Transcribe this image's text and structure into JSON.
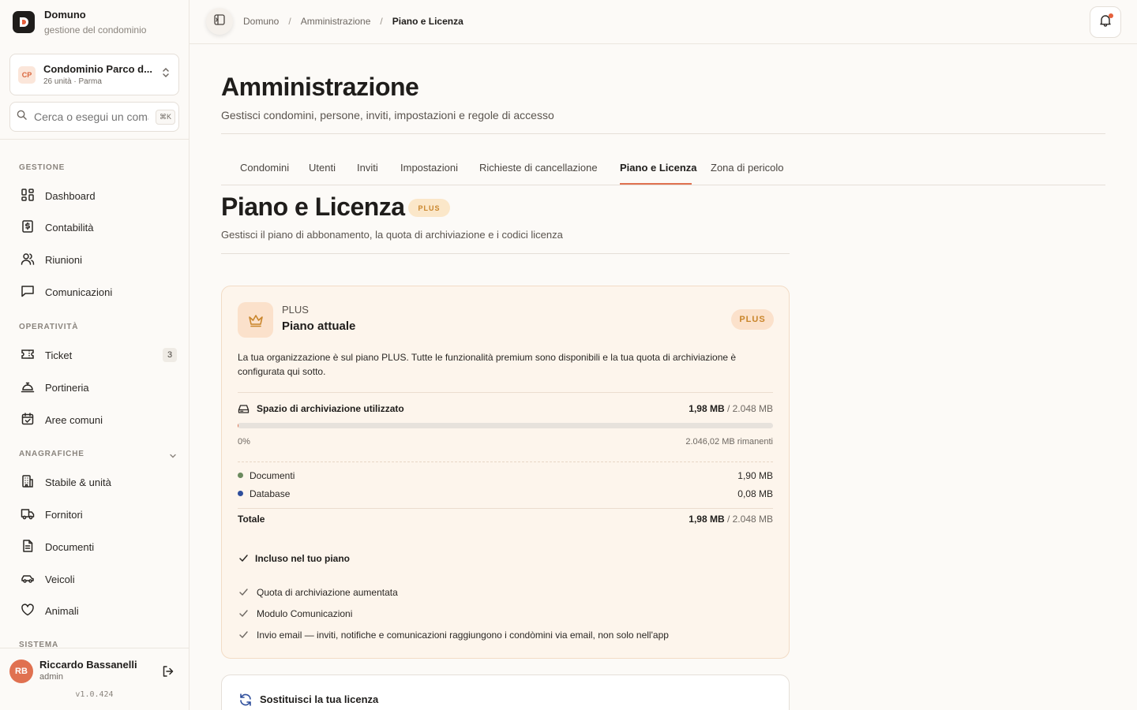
{
  "brand": {
    "name": "Domuno",
    "subtitle": "gestione del condominio"
  },
  "org": {
    "initials": "CP",
    "name": "Condominio Parco d...",
    "meta": "26 unità · Parma"
  },
  "search": {
    "placeholder": "Cerca o esegui un comando",
    "shortcut": "⌘K"
  },
  "sidebar": {
    "sections": [
      {
        "label": "GESTIONE"
      },
      {
        "label": "OPERATIVITÀ"
      },
      {
        "label": "ANAGRAFICHE"
      },
      {
        "label": "SISTEMA"
      }
    ],
    "items": [
      {
        "label": "Dashboard",
        "icon": "dashboard-icon"
      },
      {
        "label": "Contabilità",
        "icon": "ledger-icon"
      },
      {
        "label": "Riunioni",
        "icon": "users-icon"
      },
      {
        "label": "Comunicazioni",
        "icon": "message-icon"
      },
      {
        "label": "Ticket",
        "icon": "ticket-icon",
        "count": "3"
      },
      {
        "label": "Portineria",
        "icon": "concierge-bell-icon"
      },
      {
        "label": "Aree comuni",
        "icon": "calendar-check-icon"
      },
      {
        "label": "Stabile & unità",
        "icon": "building-icon"
      },
      {
        "label": "Fornitori",
        "icon": "truck-icon"
      },
      {
        "label": "Documenti",
        "icon": "document-icon"
      },
      {
        "label": "Veicoli",
        "icon": "car-icon"
      },
      {
        "label": "Animali",
        "icon": "heart-icon"
      }
    ]
  },
  "user": {
    "initials": "RB",
    "name": "Riccardo Bassanelli",
    "role": "admin",
    "version": "v1.0.424"
  },
  "breadcrumb": [
    "Domuno",
    "Amministrazione",
    "Piano e Licenza"
  ],
  "page": {
    "title": "Amministrazione",
    "subtitle": "Gestisci condomini, persone, inviti, impostazioni e regole di accesso"
  },
  "tabs": [
    "Condomini",
    "Utenti",
    "Inviti",
    "Impostazioni",
    "Richieste di cancellazione",
    "Piano e Licenza",
    "Zona di pericolo"
  ],
  "active_tab": "Piano e Licenza",
  "section": {
    "title": "Piano e Licenza",
    "badge": "PLUS",
    "subtitle": "Gestisci il piano di abbonamento, la quota di archiviazione e i codici licenza"
  },
  "plan": {
    "tier_small": "PLUS",
    "title": "Piano attuale",
    "badge": "PLUS",
    "description": "La tua organizzazione è sul piano PLUS. Tutte le funzionalità premium sono disponibili e la tua quota di archiviazione è configurata qui sotto.",
    "storage": {
      "label": "Spazio di archiviazione utilizzato",
      "used": "1,98 MB",
      "total": "/ 2.048 MB",
      "percent_label": "0%",
      "used_fraction": 0.001,
      "remaining": "2.046,02 MB rimanenti",
      "breakdown": [
        {
          "label": "Documenti",
          "value": "1,90 MB",
          "color": "#6b8a5e"
        },
        {
          "label": "Database",
          "value": "0,08 MB",
          "color": "#2f4f9c"
        }
      ],
      "total_label": "Totale",
      "total_used": "1,98 MB",
      "total_of": "/ 2.048 MB"
    },
    "included_title": "Incluso nel tuo piano",
    "features": [
      "Quota di archiviazione aumentata",
      "Modulo Comunicazioni",
      "Invio email — inviti, notifiche e comunicazioni raggiungono i condòmini via email, non solo nell'app"
    ]
  },
  "license": {
    "title": "Sostituisci la tua licenza"
  },
  "colors": {
    "accent": "#e07150",
    "plan_badge_text": "#c9852b"
  }
}
